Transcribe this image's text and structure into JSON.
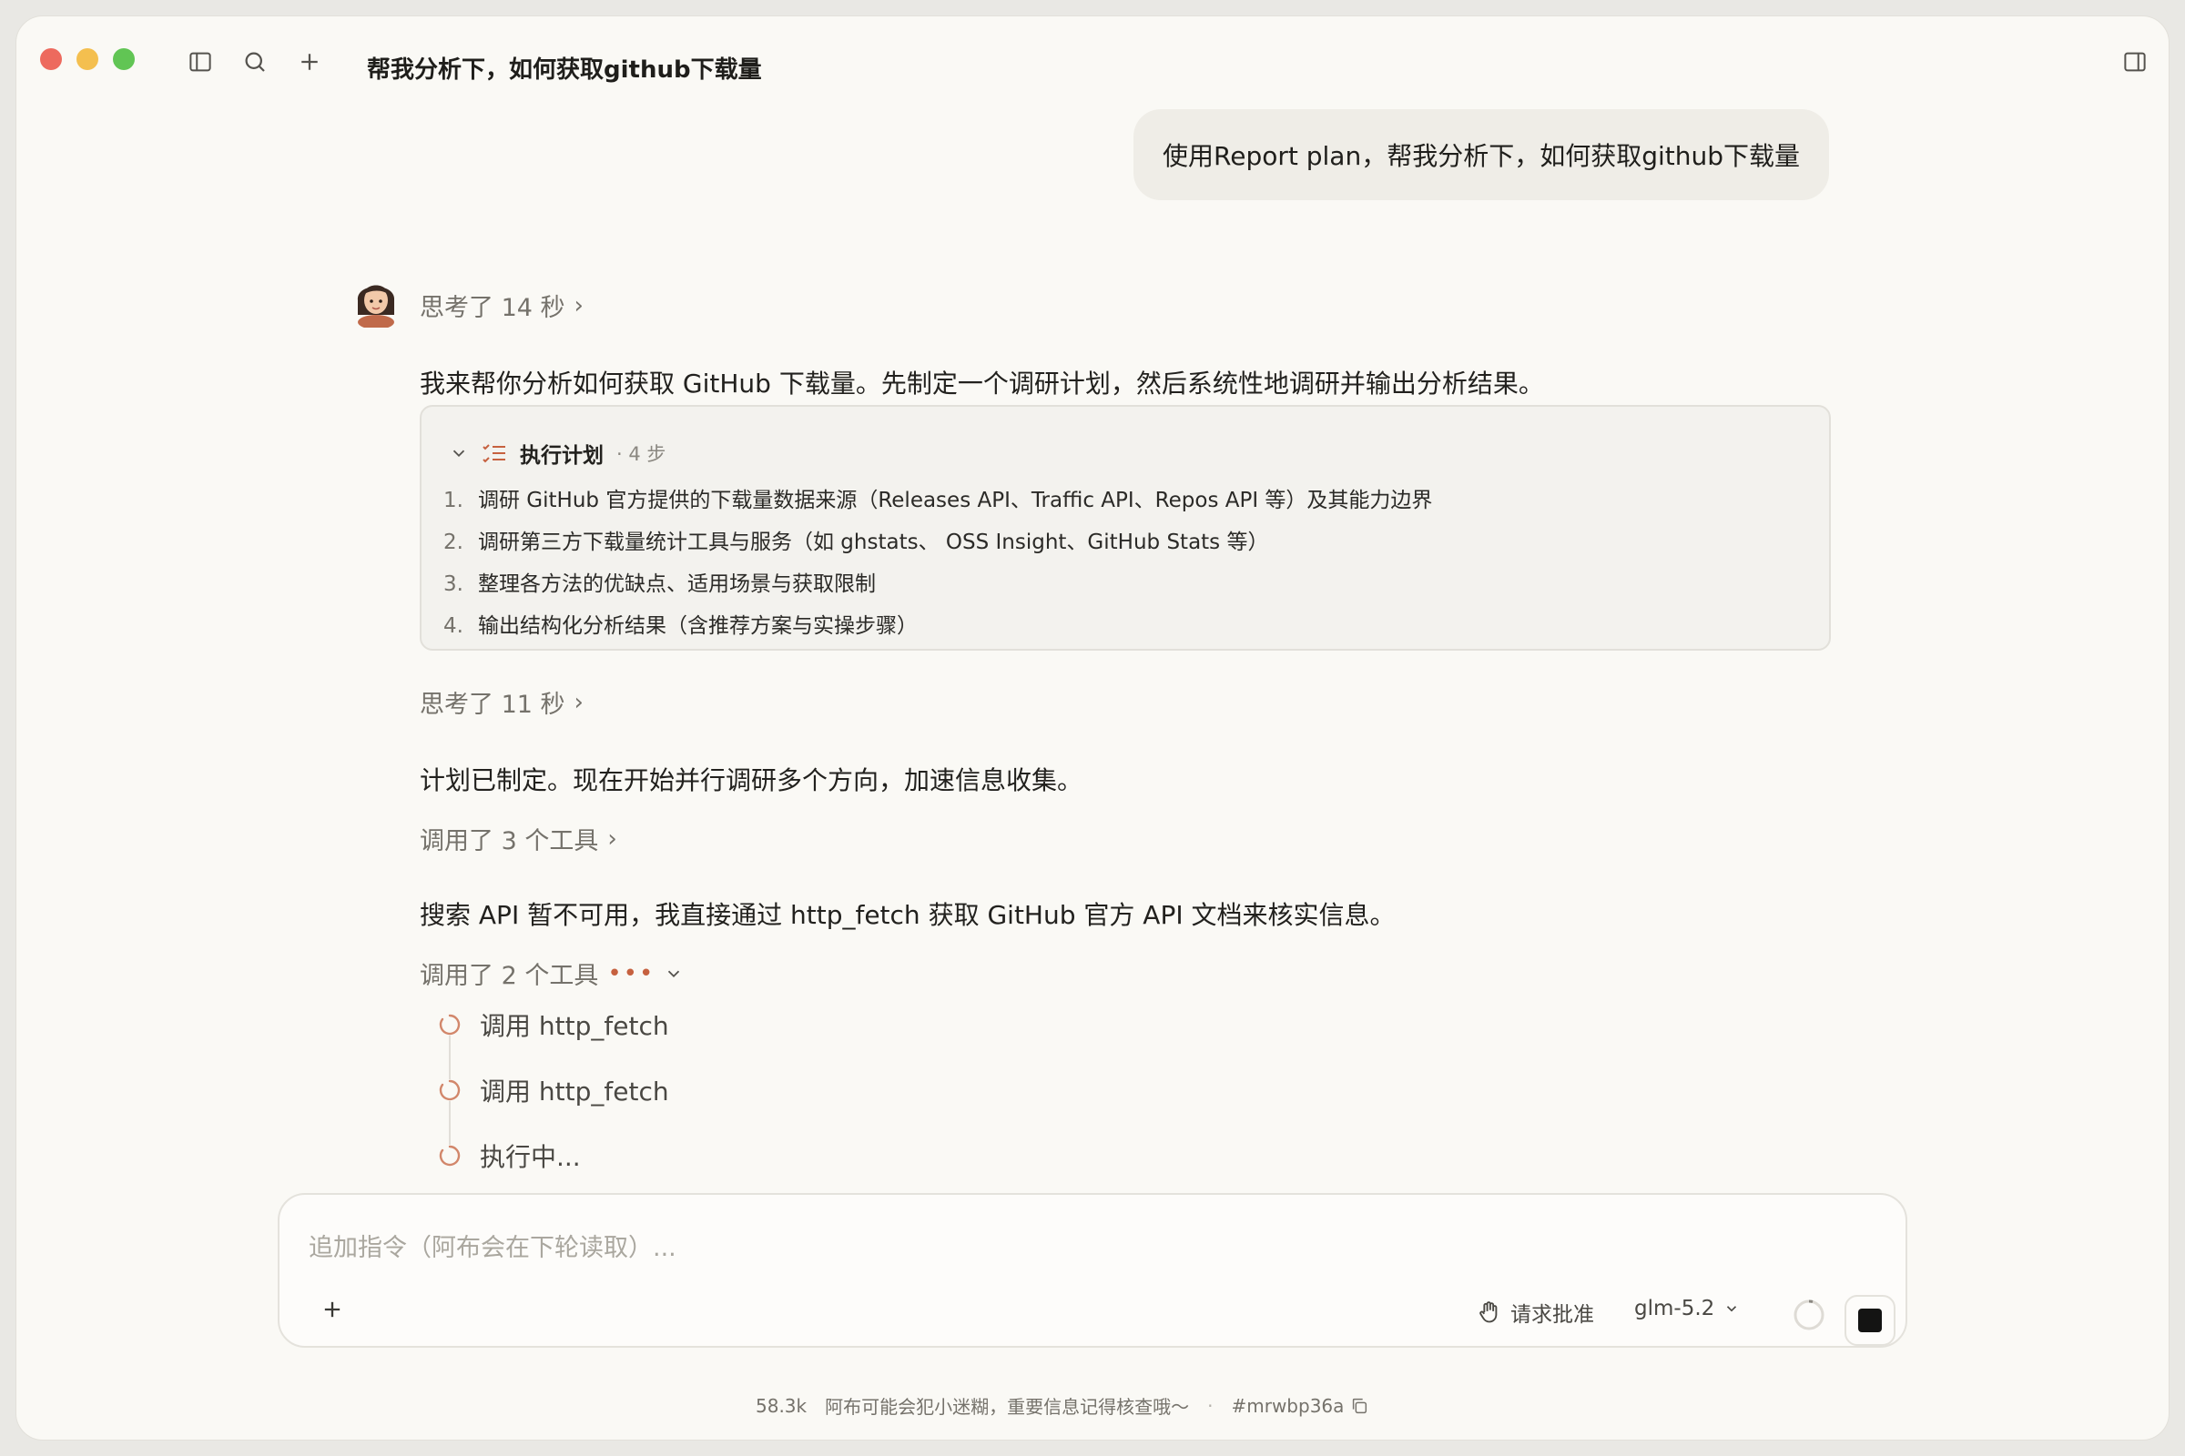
{
  "window": {
    "title": "帮我分析下，如何获取github下载量"
  },
  "user_message": "使用Report plan，帮我分析下，如何获取github下载量",
  "assistant": {
    "thinking_1": "思考了 14 秒",
    "intro": "我来帮你分析如何获取 GitHub 下载量。先制定一个调研计划，然后系统性地调研并输出分析结果。",
    "plan": {
      "title": "执行计划",
      "steps_label": "· 4 步",
      "items": [
        {
          "num": "1.",
          "text": "调研 GitHub 官方提供的下载量数据来源（Releases API、Traffic API、Repos API 等）及其能力边界"
        },
        {
          "num": "2.",
          "text": "调研第三方下载量统计工具与服务（如 ghstats、 OSS Insight、GitHub Stats 等）"
        },
        {
          "num": "3.",
          "text": "整理各方法的优缺点、适用场景与获取限制"
        },
        {
          "num": "4.",
          "text": "输出结构化分析结果（含推荐方案与实操步骤）"
        }
      ]
    },
    "thinking_2": "思考了 11 秒",
    "plan_done": "计划已制定。现在开始并行调研多个方向，加速信息收集。",
    "tools_called_1": "调用了 3 个工具",
    "search_note": "搜索 API 暂不可用，我直接通过 http_fetch 获取 GitHub 官方 API 文档来核实信息。",
    "tools_called_2": "调用了 2 个工具",
    "tool_calls": [
      {
        "label": "调用 http_fetch"
      },
      {
        "label": "调用 http_fetch"
      },
      {
        "label": "执行中..."
      }
    ]
  },
  "input": {
    "placeholder": "追加指令（阿布会在下轮读取）...",
    "approve_label": "请求批准",
    "model": "glm-5.2"
  },
  "footer": {
    "tokens": "58.3k",
    "disclaimer": "阿布可能会犯小迷糊，重要信息记得核查哦～",
    "separator": "·",
    "session_id": "#mrwbp36a"
  },
  "colors": {
    "accent": "#c6613f",
    "background": "#faf9f5"
  }
}
